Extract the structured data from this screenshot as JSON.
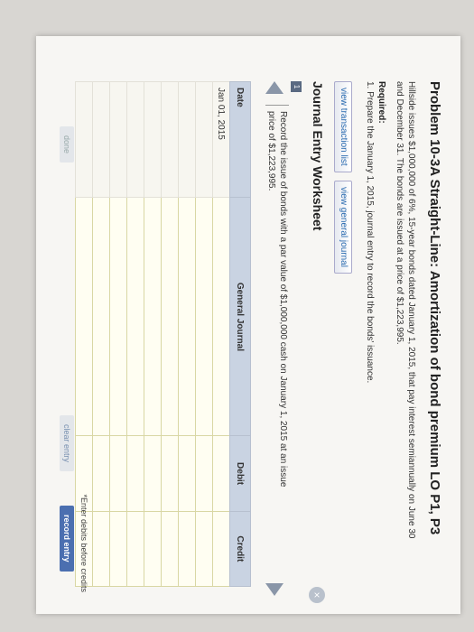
{
  "problem": {
    "title": "Problem 10-3A Straight-Line: Amortization of bond premium LO P1, P3",
    "description": "Hillside issues $1,000,000 of 6%, 15-year bonds dated January 1, 2015, that pay interest semiannually on June 30 and December 31. The bonds are issued at a price of $1,223,995.",
    "required_label": "Required:",
    "required_item": "1. Prepare the January 1, 2015, journal entry to record the bonds' issuance."
  },
  "tabs": {
    "transaction_list": "view transaction list",
    "general_journal": "view general journal"
  },
  "worksheet": {
    "title": "Journal Entry Worksheet",
    "step_number": "1",
    "instruction": "Record the issue of bonds with a par value of $1,000,000 cash on January 1, 2015 at an issue price of $1,223,995.",
    "columns": [
      "Date",
      "General Journal",
      "Debit",
      "Credit"
    ],
    "rows": [
      [
        "Jan 01, 2015",
        "",
        "",
        ""
      ],
      [
        "",
        "",
        "",
        ""
      ],
      [
        "",
        "",
        "",
        ""
      ],
      [
        "",
        "",
        "",
        ""
      ],
      [
        "",
        "",
        "",
        ""
      ],
      [
        "",
        "",
        "",
        ""
      ],
      [
        "",
        "",
        "",
        ""
      ],
      [
        "",
        "",
        "",
        ""
      ],
      [
        "",
        "",
        "",
        ""
      ]
    ],
    "note": "*Enter debits before credits"
  },
  "buttons": {
    "done": "done",
    "clear": "clear entry",
    "record": "record entry"
  },
  "icons": {
    "close": "close-icon",
    "prev": "arrow-left-icon",
    "next": "arrow-right-icon"
  }
}
